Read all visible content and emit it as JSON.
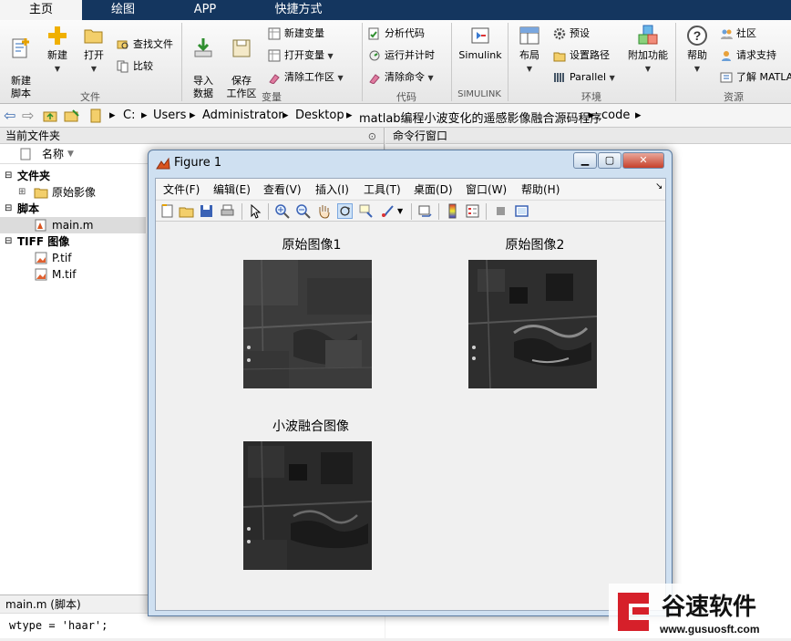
{
  "tabs": [
    "主页",
    "绘图",
    "APP",
    "快捷方式"
  ],
  "ribbon": {
    "file_group": {
      "label": "文件",
      "new_script": "新建\n脚本",
      "new": "新建",
      "open": "打开",
      "find_files": "查找文件",
      "compare": "比较"
    },
    "variable_group": {
      "label": "变量",
      "import": "导入\n数据",
      "save_workspace": "保存\n工作区",
      "new_variable": "新建变量",
      "open_variable": "打开变量",
      "clear_workspace": "清除工作区"
    },
    "code_group": {
      "label": "代码",
      "analyze": "分析代码",
      "run_time": "运行并计时",
      "clear_commands": "清除命令"
    },
    "simulink_group": {
      "label": "SIMULINK",
      "simulink": "Simulink"
    },
    "env_group": {
      "label": "环境",
      "layout": "布局",
      "preferences": "预设",
      "set_path": "设置路径",
      "parallel": "Parallel",
      "addons": "附加功能"
    },
    "resources_group": {
      "label": "资源",
      "help": "帮助",
      "community": "社区",
      "request_support": "请求支持",
      "learn_matlab": "了解 MATLA"
    }
  },
  "address": [
    "C:",
    "Users",
    "Administrator",
    "Desktop",
    "matlab编程小波变化的遥感影像融合源码程序",
    "code"
  ],
  "left_panel": {
    "title": "当前文件夹",
    "col_name": "名称",
    "tree": [
      {
        "label": "文件夹",
        "bold": true
      },
      {
        "label": "原始影像"
      },
      {
        "label": "脚本",
        "bold": true
      },
      {
        "label": "main.m"
      },
      {
        "label": "TIFF 图像",
        "bold": true
      },
      {
        "label": "P.tif"
      },
      {
        "label": "M.tif"
      }
    ],
    "detail_title": "main.m  (脚本)",
    "detail_code": "wtype = 'haar';"
  },
  "command_window": {
    "title": "命令行窗口"
  },
  "figure": {
    "title": "Figure 1",
    "menu": [
      "文件(F)",
      "编辑(E)",
      "查看(V)",
      "插入(I)",
      "工具(T)",
      "桌面(D)",
      "窗口(W)",
      "帮助(H)"
    ],
    "plots": [
      "原始图像1",
      "原始图像2",
      "小波融合图像"
    ]
  },
  "watermark": {
    "brand": "谷速软件",
    "url": "www.gusuosft.com"
  },
  "colors": {
    "tabbar": "#14365f",
    "accent": "#d6202a"
  }
}
